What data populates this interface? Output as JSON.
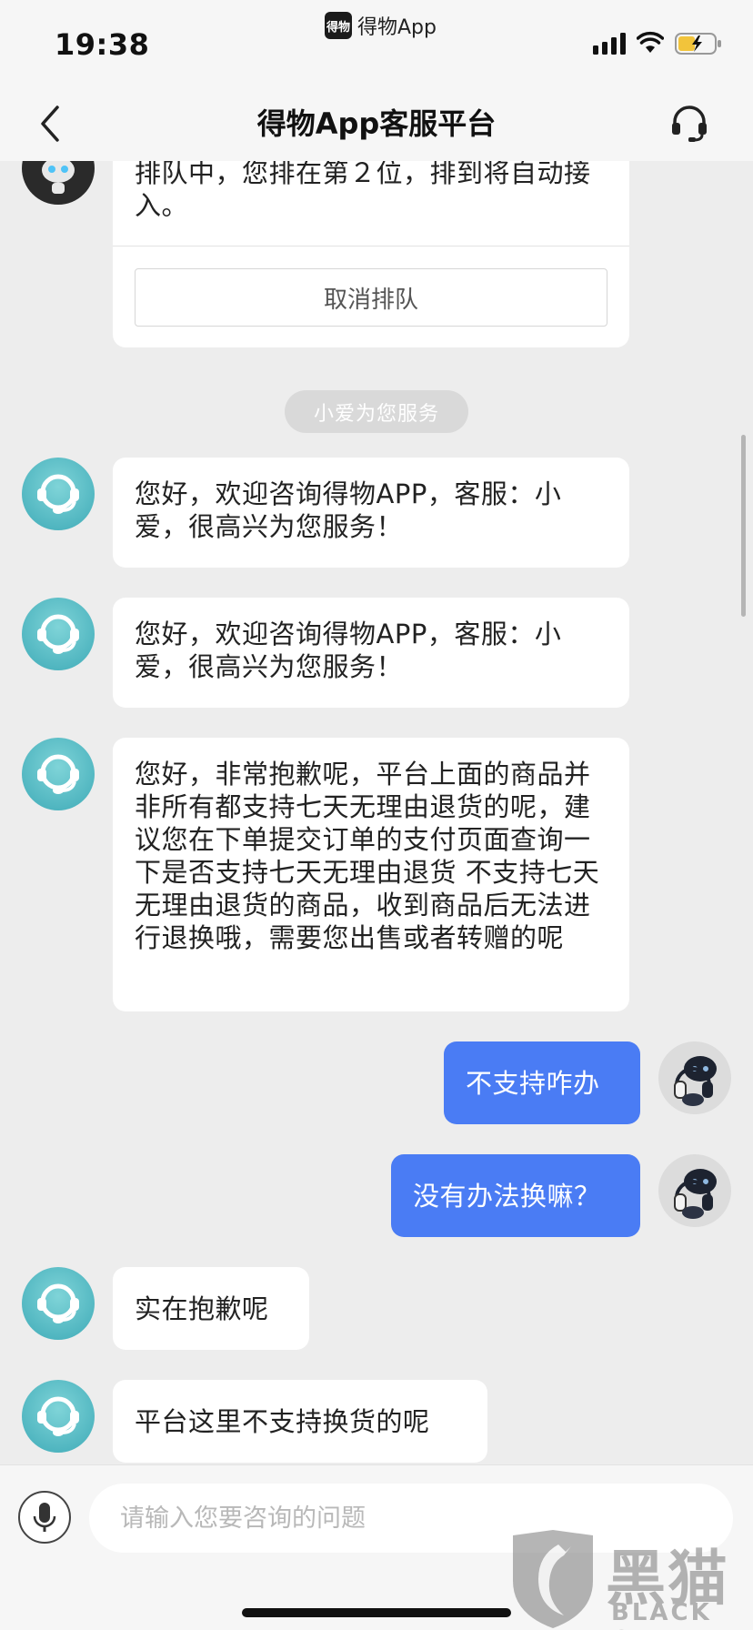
{
  "status_bar": {
    "time": "19:38",
    "app_badge": "得物",
    "app_name": "得物App"
  },
  "header": {
    "title": "得物App客服平台",
    "back_icon": "chevron-left-icon",
    "service_icon": "headset-icon"
  },
  "queue": {
    "text": "排队中，您排在第２位，排到将自动接入。",
    "cancel_label": "取消排队"
  },
  "system_notice": "小爱为您服务",
  "messages": [
    {
      "from": "agent",
      "text": "您好，欢迎咨询得物APP，客服：小爱，很高兴为您服务！"
    },
    {
      "from": "agent",
      "text": "您好，欢迎咨询得物APP，客服：小爱，很高兴为您服务！"
    },
    {
      "from": "agent",
      "text": "您好，非常抱歉呢，平台上面的商品并非所有都支持七天无理由退货的呢，建议您在下单提交订单的支付页面查询一下是否支持七天无理由退货  不支持七天无理由退货的商品，收到商品后无法进行退换哦，需要您出售或者转赠的呢"
    },
    {
      "from": "user",
      "text": "不支持咋办"
    },
    {
      "from": "user",
      "text": "没有办法换嘛？"
    },
    {
      "from": "agent",
      "text": "实在抱歉呢"
    },
    {
      "from": "agent",
      "text": "平台这里不支持换货的呢"
    }
  ],
  "input": {
    "placeholder": "请输入您要咨询的问题",
    "value": ""
  },
  "watermark": {
    "cn": "黑猫",
    "en": "BLACK CAT"
  },
  "colors": {
    "user_bubble": "#4a7cf4",
    "agent_avatar": "#4db5c0",
    "background": "#ededed"
  }
}
